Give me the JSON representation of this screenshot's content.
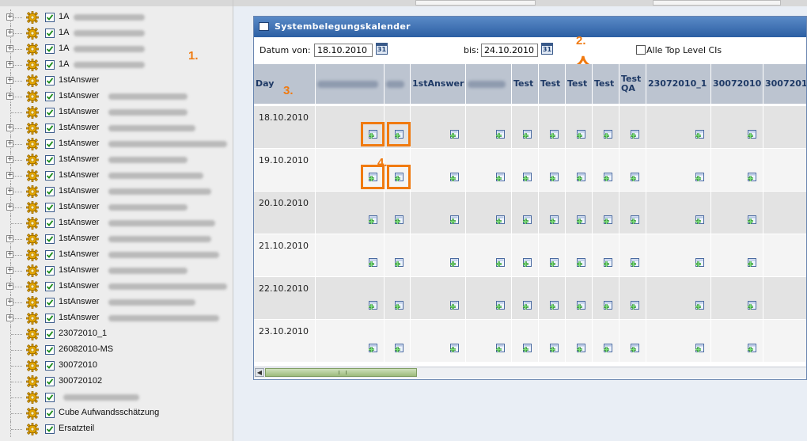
{
  "tree": {
    "items": [
      {
        "label": "1A",
        "blurred_suffix": true,
        "expander": "+"
      },
      {
        "label": "1A",
        "blurred_suffix": true,
        "expander": "+"
      },
      {
        "label": "1A",
        "blurred_suffix": true,
        "expander": "+"
      },
      {
        "label": "1A",
        "blurred_suffix": true,
        "expander": "+"
      },
      {
        "label": "1stAnswer",
        "blurred_suffix": false,
        "expander": "+"
      },
      {
        "label": "1stAnswer",
        "blurred_suffix": true,
        "expander": "+"
      },
      {
        "label": "1stAnswer",
        "blurred_suffix": true,
        "expander": ""
      },
      {
        "label": "1stAnswer",
        "blurred_suffix": true,
        "expander": "+"
      },
      {
        "label": "1stAnswer",
        "blurred_suffix": true,
        "expander": "+"
      },
      {
        "label": "1stAnswer",
        "blurred_suffix": true,
        "expander": "+"
      },
      {
        "label": "1stAnswer",
        "blurred_suffix": true,
        "expander": "+"
      },
      {
        "label": "1stAnswer",
        "blurred_suffix": true,
        "expander": "+"
      },
      {
        "label": "1stAnswer",
        "blurred_suffix": true,
        "expander": "+"
      },
      {
        "label": "1stAnswer",
        "blurred_suffix": true,
        "expander": ""
      },
      {
        "label": "1stAnswer",
        "blurred_suffix": true,
        "expander": "+"
      },
      {
        "label": "1stAnswer",
        "blurred_suffix": true,
        "expander": "+"
      },
      {
        "label": "1stAnswer",
        "blurred_suffix": true,
        "expander": "+"
      },
      {
        "label": "1stAnswer",
        "blurred_suffix": true,
        "expander": "+"
      },
      {
        "label": "1stAnswer",
        "blurred_suffix": true,
        "expander": "+"
      },
      {
        "label": "1stAnswer",
        "blurred_suffix": true,
        "expander": "+"
      },
      {
        "label": "23072010_1",
        "blurred_suffix": false,
        "expander": ""
      },
      {
        "label": "26082010-MS",
        "blurred_suffix": false,
        "expander": ""
      },
      {
        "label": "30072010",
        "blurred_suffix": false,
        "expander": ""
      },
      {
        "label": "300720102",
        "blurred_suffix": false,
        "expander": ""
      },
      {
        "label": "",
        "blurred_suffix": true,
        "expander": ""
      },
      {
        "label": "Cube Aufwandsschätzung",
        "blurred_suffix": false,
        "expander": ""
      },
      {
        "label": "Ersatzteil",
        "blurred_suffix": false,
        "expander": ""
      }
    ]
  },
  "annotations": {
    "a1": "1.",
    "a2": "2.",
    "a3": "3.",
    "a4": "4."
  },
  "window": {
    "title": "Systembelegungskalender",
    "datum_von_label": "Datum von:",
    "datum_von_value": "18.10.2010",
    "bis_label": "bis:",
    "bis_value": "24.10.2010",
    "calendar_icon_text": "31",
    "all_top_level_label": "Alle Top Level CIs",
    "columns": [
      "Day",
      "",
      "",
      "1stAnswer",
      "",
      "Test",
      "Test",
      "Test",
      "Test",
      "Test QA",
      "23072010_1",
      "30072010",
      "3007201"
    ],
    "rows": [
      {
        "day": "18.10.2010"
      },
      {
        "day": "19.10.2010"
      },
      {
        "day": "20.10.2010"
      },
      {
        "day": "21.10.2010"
      },
      {
        "day": "22.10.2010"
      },
      {
        "day": "23.10.2010"
      }
    ]
  },
  "colors": {
    "accent_orange": "#f07a10",
    "title_blue": "#2c5fa3",
    "header_bg": "#bcc4d0",
    "row_alt": "#e3e3e3",
    "add_green": "#3aa83a"
  }
}
